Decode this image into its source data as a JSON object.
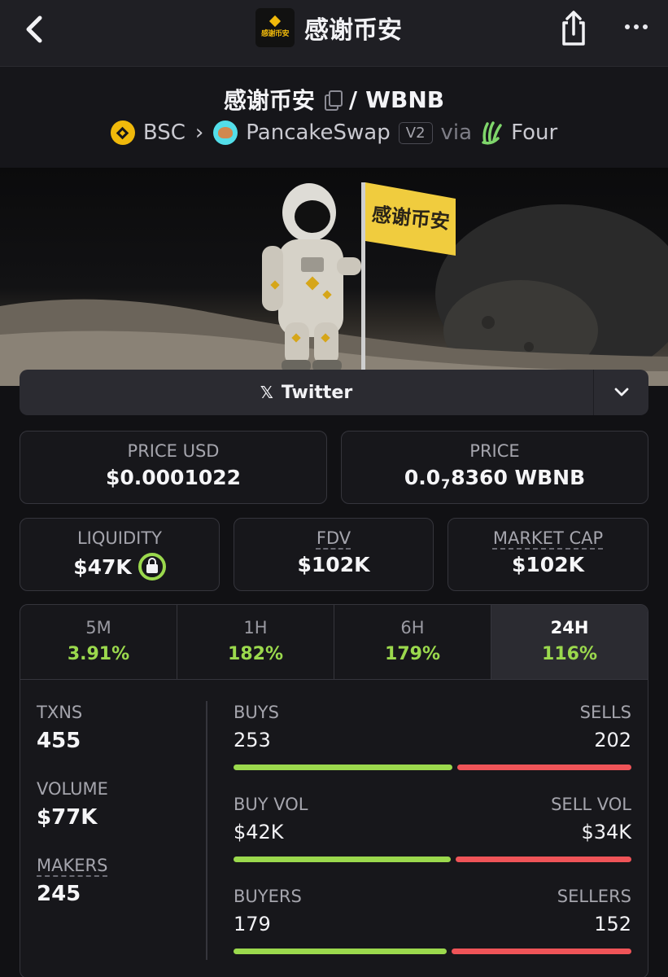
{
  "header": {
    "title": "感谢币安",
    "logo_text": "感谢币安"
  },
  "pair": {
    "base": "感谢币安",
    "separator": "/",
    "quote": "WBNB",
    "chain": "BSC",
    "dex": "PancakeSwap",
    "dex_version": "V2",
    "via_label": "via",
    "launchpad": "Four"
  },
  "banner": {
    "flag_text": "感谢币安"
  },
  "links": {
    "twitter_label": "Twitter"
  },
  "stats": {
    "price_usd_label": "PRICE USD",
    "price_usd": "$0.0001022",
    "price_label": "PRICE",
    "price_prefix": "0.0",
    "price_zero_count": "7",
    "price_suffix": "8360 WBNB",
    "liquidity_label": "LIQUIDITY",
    "liquidity": "$47K",
    "fdv_label": "FDV",
    "fdv": "$102K",
    "market_cap_label": "MARKET CAP",
    "market_cap": "$102K"
  },
  "performance": [
    {
      "label": "5M",
      "value": "3.91%"
    },
    {
      "label": "1H",
      "value": "182%"
    },
    {
      "label": "6H",
      "value": "179%"
    },
    {
      "label": "24H",
      "value": "116%",
      "active": true
    }
  ],
  "activity": {
    "txns_label": "TXNS",
    "txns": "455",
    "volume_label": "VOLUME",
    "volume": "$77K",
    "makers_label": "MAKERS",
    "makers": "245",
    "buys_label": "BUYS",
    "buys": "253",
    "sells_label": "SELLS",
    "sells": "202",
    "buy_vol_label": "BUY VOL",
    "buy_vol": "$42K",
    "sell_vol_label": "SELL VOL",
    "sell_vol": "$34K",
    "buyers_label": "BUYERS",
    "buyers": "179",
    "sellers_label": "SELLERS",
    "sellers": "152",
    "buys_ratio": 0.556,
    "buy_vol_ratio": 0.553,
    "buyers_ratio": 0.541
  },
  "colors": {
    "positive": "#9bd94d",
    "negative": "#ef5458",
    "brand": "#f0b90b"
  }
}
